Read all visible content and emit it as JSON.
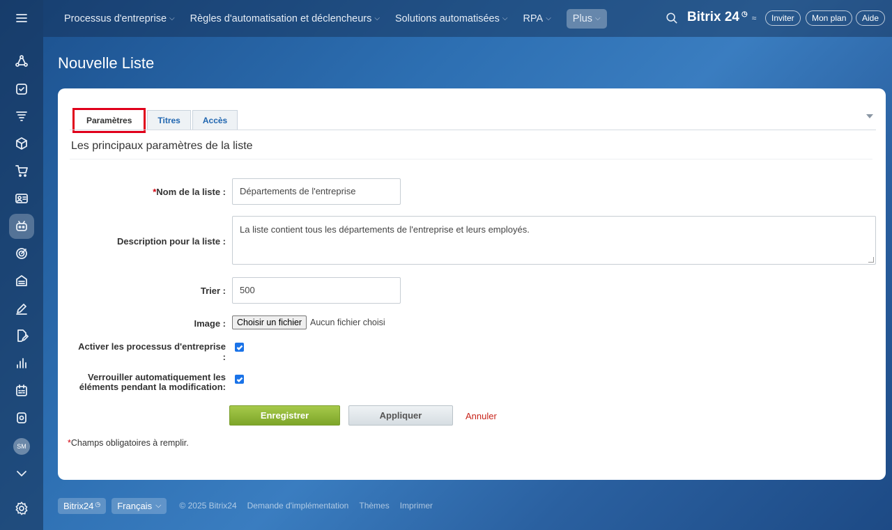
{
  "topnav": {
    "items": [
      "Processus d'entreprise",
      "Règles d'automatisation et déclencheurs",
      "Solutions automatisées",
      "RPA"
    ],
    "plus_label": "Plus",
    "brand": "Bitrix 24",
    "invite": "Inviter",
    "plan": "Mon plan",
    "help": "Aide"
  },
  "sidebar": {
    "avatar_initials": "SM",
    "icons": [
      "flow-icon",
      "task-icon",
      "filter-icon",
      "box-icon",
      "cart-icon",
      "contact-card-icon",
      "robot-icon",
      "target-icon",
      "archive-icon",
      "pen-icon",
      "document-edit-icon",
      "chart-icon",
      "calendar-icon",
      "radio-icon",
      "chevron-down-icon"
    ]
  },
  "page": {
    "title": "Nouvelle Liste"
  },
  "tabs": [
    "Paramètres",
    "Titres",
    "Accès"
  ],
  "form": {
    "section_title": "Les principaux paramètres de la liste",
    "name_label": "Nom de la liste :",
    "name_value": "Départements de l'entreprise",
    "desc_label": "Description pour la liste :",
    "desc_value": "La liste contient tous les départements de l'entreprise et leurs employés.",
    "sort_label": "Trier :",
    "sort_value": "500",
    "image_label": "Image :",
    "file_button": "Choisir un fichier",
    "file_status": "Aucun fichier choisi",
    "bp_label_line1": "Activer les processus d'entreprise",
    "bp_label_line2": ":",
    "lock_label_line1": "Verrouiller automatiquement les",
    "lock_label_line2": "éléments pendant la modification:",
    "save": "Enregistrer",
    "apply": "Appliquer",
    "cancel": "Annuler",
    "required_note": "Champs obligatoires à remplir.",
    "required_mark": "*"
  },
  "footer": {
    "brand": "Bitrix24",
    "language": "Français",
    "copyright": "© 2025 Bitrix24",
    "implementation": "Demande d'implémentation",
    "themes": "Thèmes",
    "print": "Imprimer"
  },
  "colors": {
    "required": "#d2000d",
    "save_button": "#8db535",
    "active_tab_highlight": "#e0001b",
    "link": "#2066b0",
    "cancel": "#c8231a"
  }
}
